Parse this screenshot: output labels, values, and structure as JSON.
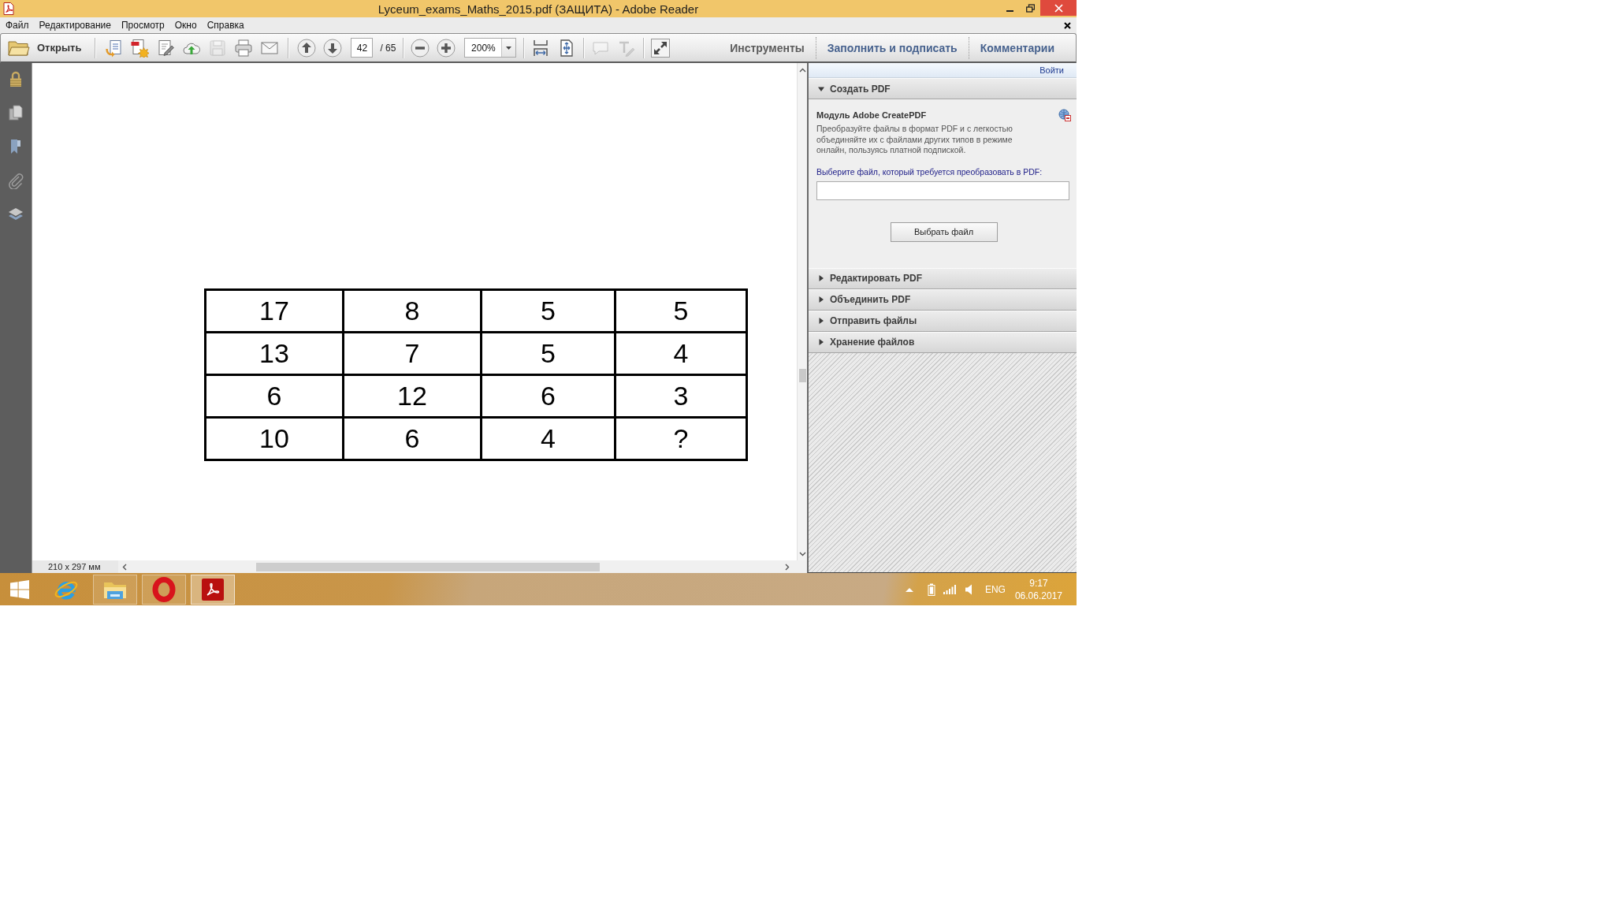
{
  "window": {
    "title": "Lyceum_exams_Maths_2015.pdf (ЗАЩИТА) - Adobe Reader"
  },
  "menu_bar": {
    "items": [
      "Файл",
      "Редактирование",
      "Просмотр",
      "Окно",
      "Справка"
    ]
  },
  "toolbar": {
    "open_button": "Открыть",
    "file_tools": [
      {
        "kind": "export",
        "disabled": false
      },
      {
        "kind": "create",
        "disabled": false
      },
      {
        "kind": "sign",
        "disabled": false
      },
      {
        "kind": "upload",
        "disabled": false
      },
      {
        "kind": "save",
        "disabled": true
      },
      {
        "kind": "print",
        "disabled": false
      },
      {
        "kind": "email",
        "disabled": false
      }
    ],
    "page_navigation": {
      "buttons": [
        {
          "kind": "previous",
          "disabled": false
        },
        {
          "kind": "next",
          "disabled": false
        }
      ],
      "page_number": "42",
      "page_count": "/ 65"
    },
    "zoom": {
      "buttons": [
        {
          "kind": "out",
          "disabled": false
        },
        {
          "kind": "in",
          "disabled": false
        }
      ],
      "value": "200%"
    },
    "view_tools": [
      {
        "kind": "scroll",
        "disabled": false
      },
      {
        "kind": "fit",
        "disabled": false
      }
    ],
    "comment_tools": [
      {
        "kind": "note",
        "disabled": true
      },
      {
        "kind": "text",
        "disabled": true
      }
    ],
    "fullscreen_tools": [
      {
        "kind": "fullscreen",
        "disabled": false
      }
    ],
    "tabs": [
      {
        "label": "Инструменты",
        "selected": true
      },
      {
        "label": "Заполнить и подписать",
        "selected": false
      },
      {
        "label": "Комментарии",
        "selected": false
      }
    ]
  },
  "document": {
    "table": {
      "rows": [
        [
          "17",
          "8",
          "5",
          "5"
        ],
        [
          "13",
          "7",
          "5",
          "4"
        ],
        [
          "6",
          "12",
          "6",
          "3"
        ],
        [
          "10",
          "6",
          "4",
          "?"
        ]
      ]
    },
    "page_size": "210 x 297 мм"
  },
  "tools_panel": {
    "sign_in": "Войти",
    "sections": [
      {
        "title": "Создать PDF",
        "expanded": true,
        "module": {
          "title": "Модуль Adobe CreatePDF",
          "description": "Преобразуйте файлы в формат PDF и с легкостью объединяйте их с файлами других типов в режиме онлайн, пользуясь платной подпиской.",
          "prompt": "Выберите файл, который требуется преобразовать в PDF:",
          "button": "Выбрать файл"
        }
      },
      {
        "title": "Редактировать PDF",
        "expanded": false
      },
      {
        "title": "Объединить PDF",
        "expanded": false
      },
      {
        "title": "Отправить файлы",
        "expanded": false
      },
      {
        "title": "Хранение файлов",
        "expanded": false
      }
    ]
  },
  "taskbar": {
    "apps": [
      {
        "kind": "browser",
        "running": false,
        "selected": false
      },
      {
        "kind": "files",
        "running": true,
        "selected": false
      },
      {
        "kind": "ring",
        "running": true,
        "selected": false
      },
      {
        "kind": "reader",
        "running": true,
        "selected": true
      }
    ],
    "language": "ENG",
    "time": "9:17",
    "date": "06.06.2017"
  }
}
